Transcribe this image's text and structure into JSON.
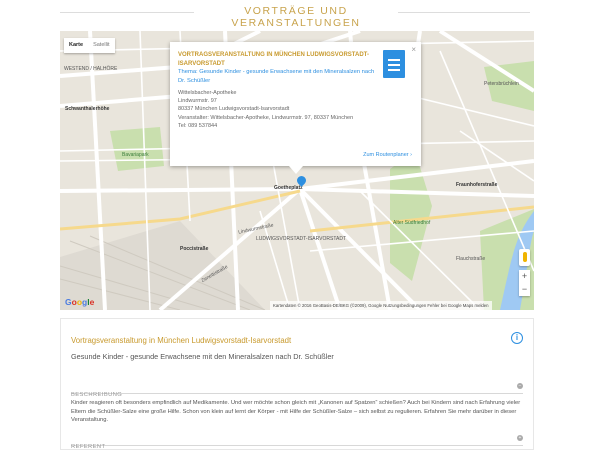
{
  "header": {
    "title": "VORTRÄGE UND VERANSTALTUNGEN"
  },
  "map": {
    "maptype_map": "Karte",
    "maptype_satellite": "Satellit",
    "labels": {
      "l1": "WESTEND / HALHÖRE",
      "l2": "Schwanthalerhöhe",
      "l3": "Bavariapark",
      "l4": "Goetheplatz",
      "l5": "LUDWIGSVORSTADT-ISARVORSTADT",
      "l6": "Poccistraße",
      "l7": "Fraunhoferstraße",
      "l8": "Alter Südfriedhof",
      "l9": "Petersbrüchlein",
      "l10": "Lindwurmstraße",
      "l11": "Zenettistraße",
      "l12": "Flauchstraße"
    },
    "popup": {
      "title": "Vortragsveranstaltung in München Ludwigsvorstadt-Isarvorstadt",
      "theme": "Thema: Gesunde Kinder - gesunde Erwachsene mit den Mineralsalzen nach Dr. Schüßler",
      "addr1": "Wittelsbacher-Apotheke",
      "addr2": "Lindwurmstr. 97",
      "addr3": "80337 München Ludwigsvorstadt-Isarvorstadt",
      "addr4": "Veranstalter: Wittelsbacher-Apotheke, Lindwurmstr. 97, 80337 München",
      "addr5": "Tel: 089 537844",
      "route": "Zum Routenplaner ›"
    },
    "zoom_in": "+",
    "zoom_out": "−",
    "attribution": "Kartendaten © 2016 GeoBasis-DE/BKG (©2009), Google    Nutzungsbedingungen    Fehler bei Google Maps melden",
    "colors": {
      "accent": "#c89a2e",
      "link": "#2d8fe0"
    }
  },
  "panel": {
    "title": "Vortragsveranstaltung in München Ludwigsvorstadt-Isarvorstadt",
    "subtitle": "Gesunde Kinder - gesunde Erwachsene mit den Mineralsalzen nach Dr. Schüßler",
    "info_icon": "i",
    "section1": "Beschreibung",
    "description": "Kinder reagieren oft besonders empfindlich auf Medikamente. Und wer möchte schon gleich mit „Kanonen auf Spatzen“ schießen? Auch bei Kindern sind nach Erfahrung vieler Eltern die Schüßler-Salze eine große Hilfe. Schon von klein auf lernt der Körper - mit Hilfe der Schüßler-Salze – sich selbst zu regulieren. Erfahren Sie mehr darüber in dieser Veranstaltung.",
    "section2": "Referent",
    "toggle": "+"
  }
}
